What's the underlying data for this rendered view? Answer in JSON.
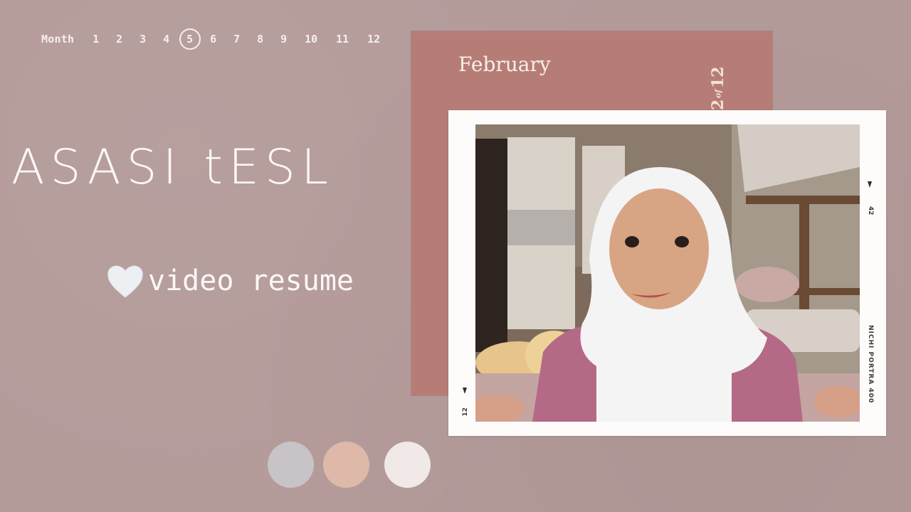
{
  "month_strip": {
    "label": "Month",
    "months": [
      "1",
      "2",
      "3",
      "4",
      "5",
      "6",
      "7",
      "8",
      "9",
      "10",
      "11",
      "12"
    ],
    "current": "5"
  },
  "title": {
    "main": "ASASI tESL",
    "subtitle": "video resume",
    "subtitle_icon": "white-heart-icon"
  },
  "calendar_card": {
    "month_name": "February",
    "page_current": "2",
    "page_of": "of",
    "page_total": "12",
    "color": "#b67d77"
  },
  "photo_frame": {
    "right_frame_number": "42",
    "film_label": "NICHI PORTRA 400",
    "left_frame_number": "12",
    "photo_description": "Woman in white hijab and pink top smiling in a bedroom"
  },
  "palette": {
    "swatches": [
      {
        "name": "grey",
        "color": "#c8c3c6"
      },
      {
        "name": "peach",
        "color": "#deb9aa"
      },
      {
        "name": "off-white",
        "color": "#f0e9e8"
      }
    ]
  },
  "colors": {
    "background": "#b49b9a",
    "text": "#fbf7f6"
  }
}
